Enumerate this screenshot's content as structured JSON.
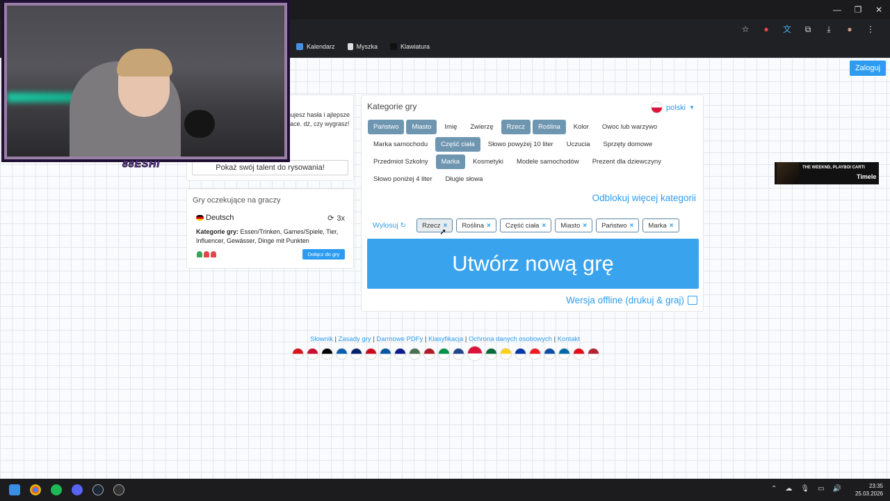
{
  "browser": {
    "bookmarks": [
      "Kalendarz",
      "Myszka",
      "Klawiatura"
    ]
  },
  "header": {
    "login_label": "Zaloguj"
  },
  "intro": {
    "text": "ysujesz hasła i ajlepsze prace. dź, czy wygrasz!",
    "talent_button": "Pokaż swój talent do rysowania!"
  },
  "waiting": {
    "title": "Gry oczekujące na graczy",
    "language": "Deutsch",
    "rounds": "3x",
    "categories_label": "Kategorie gry:",
    "categories": "Essen/Trinken, Games/Spiele, Tier, Influencer, Gewässer, Dinge mit Punkten",
    "join_label": "Dołącz do gry",
    "players": [
      "#3aa35a",
      "#e04848",
      "#e04848"
    ]
  },
  "main": {
    "title": "Kategorie gry",
    "language_selected": "polski",
    "categories": [
      {
        "label": "Państwo",
        "selected": true
      },
      {
        "label": "Miasto",
        "selected": true
      },
      {
        "label": "Imię",
        "selected": false
      },
      {
        "label": "Zwierzę",
        "selected": false
      },
      {
        "label": "Rzecz",
        "selected": true
      },
      {
        "label": "Roślina",
        "selected": true
      },
      {
        "label": "Kolor",
        "selected": false
      },
      {
        "label": "Owoc lub warzywo",
        "selected": false
      },
      {
        "label": "Marka samochodu",
        "selected": false
      },
      {
        "label": "Część ciała",
        "selected": true
      },
      {
        "label": "Słowo powyżej 10 liter",
        "selected": false
      },
      {
        "label": "Uczucia",
        "selected": false
      },
      {
        "label": "Sprzęty domowe",
        "selected": false
      },
      {
        "label": "Przedmiot Szkolny",
        "selected": false
      },
      {
        "label": "Marka",
        "selected": true
      },
      {
        "label": "Kosmetyki",
        "selected": false
      },
      {
        "label": "Modele samochodów",
        "selected": false
      },
      {
        "label": "Prezent dla dziewczyny",
        "selected": false
      },
      {
        "label": "Słowo poniżej 4 liter",
        "selected": false
      },
      {
        "label": "Długie słowa",
        "selected": false
      }
    ],
    "unlock_label": "Odblokuj więcej kategorii",
    "draw_label": "Wylosuj",
    "chips": [
      "Rzecz",
      "Roślina",
      "Część ciała",
      "Miasto",
      "Państwo",
      "Marka"
    ],
    "create_label": "Utwórz nową grę",
    "offline_label": "Wersja offline (drukuj & graj)"
  },
  "footer": {
    "links": [
      "Słownik",
      "Zasady gry",
      "Darmowe PDFy",
      "Klasyfikacja",
      "Ochrona danych osobowych",
      "Kontakt"
    ],
    "flag_colors": [
      "#d7141a",
      "#c8102e",
      "#000000",
      "#0d5eaf",
      "#012169",
      "#c60b1e",
      "#0055a4",
      "#0c1c8c",
      "#477050",
      "#ae1c28",
      "#009246",
      "#21468b",
      "#dc143c",
      "#046a38",
      "#fcd116",
      "#0039a6",
      "#ed1c24",
      "#0b4ea2",
      "#006aa7",
      "#e30a17",
      "#b22234"
    ]
  },
  "ad": {
    "line1": "THE WEEKND, PLAYBOI CARTI",
    "line2": "Timele"
  },
  "webcam": {
    "logo": "88ESHI"
  },
  "taskbar": {
    "time": "23:35",
    "date": "25.03.2026"
  }
}
